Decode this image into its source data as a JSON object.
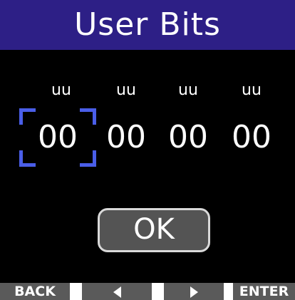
{
  "title": "User Bits",
  "fields": [
    {
      "label": "uu",
      "value": "00"
    },
    {
      "label": "uu",
      "value": "00"
    },
    {
      "label": "uu",
      "value": "00"
    },
    {
      "label": "uu",
      "value": "00"
    }
  ],
  "selected_field_index": 0,
  "ok_label": "OK",
  "footer": {
    "back_label": "BACK",
    "left_icon": "left-arrow-icon",
    "right_icon": "right-arrow-icon",
    "enter_label": "ENTER"
  },
  "colors": {
    "title_bar": "#2d1f86",
    "cursor": "#4a5ee8",
    "footer_button": "#5a5a5a",
    "ok_button": "#545454"
  }
}
